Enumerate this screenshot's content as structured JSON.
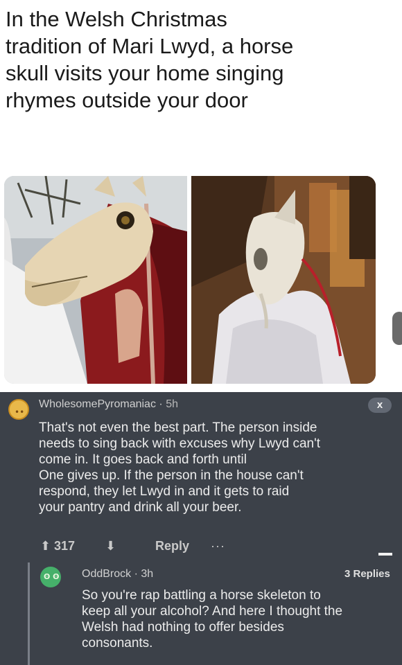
{
  "caption": {
    "line1": "In the Welsh Christmas",
    "line2": "tradition of Mari Lwyd, a horse",
    "line3": "skull visits your home singing",
    "line4": "rhymes outside your door"
  },
  "images": {
    "left_alt": "horse-skull-costume-red-cloak",
    "right_alt": "horse-skull-costume-white-sheet-at-night"
  },
  "comment": {
    "username": "WholesomePyromaniac",
    "separator": "·",
    "time": "5h",
    "close_label": "x",
    "body_lines": [
      "That's not even the best part. The person inside",
      "needs to sing back with excuses why Lwyd can't",
      "come in. It goes back and forth until",
      "One gives up. If the person in the house can't",
      "respond, they let Lwyd in and it gets to raid",
      "your pantry and drink all your beer."
    ],
    "upvotes": "317",
    "upvote_icon": "⬆",
    "downvote_icon": "⬇",
    "reply_label": "Reply",
    "more_label": "···"
  },
  "reply": {
    "username": "OddBrock",
    "separator": "·",
    "time": "3h",
    "replies_count": "3 Replies",
    "body_lines": [
      "So you're rap battling a horse skeleton to",
      "keep all your alcohol? And here I thought the",
      "Welsh had nothing to offer besides",
      "consonants."
    ]
  },
  "colors": {
    "comment_bg": "#3c4149",
    "avatar1": "#e8b84a",
    "avatar2": "#46b06a"
  }
}
